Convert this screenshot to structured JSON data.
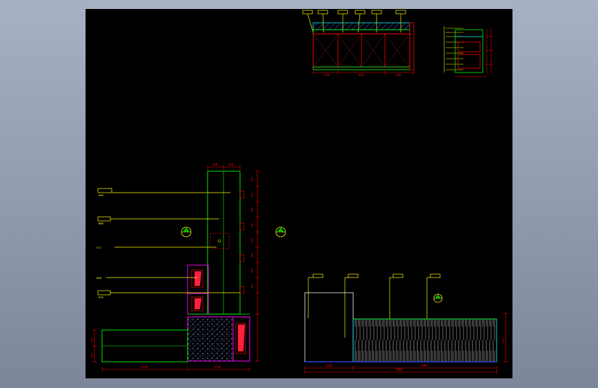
{
  "window": {
    "background_top": "#a7b0c2",
    "background_bottom": "#7d879c",
    "viewport_color": "#000000"
  },
  "colors": {
    "yellow": "#ffff00",
    "red": "#ff0000",
    "green": "#00ff00",
    "cyan": "#00ffff",
    "magenta": "#ff00ff",
    "white": "#ffffff",
    "blue": "#3050ff",
    "grey": "#8c8c8c"
  },
  "plan_view": {
    "label_texts": [
      "AAA",
      "BBB",
      "CCC",
      "DDD",
      "EEE"
    ],
    "dims_bottom": [
      "2140",
      "1550"
    ],
    "dims_left": [
      "450",
      "450"
    ],
    "dims_top": [
      "350",
      "150"
    ],
    "dims_right": [
      "600",
      "600",
      "600",
      "600",
      "600",
      "600",
      "600",
      "600"
    ],
    "section_markers": [
      "section-marker-a",
      "section-marker-b"
    ]
  },
  "elevation": {
    "dims_bottom": [
      "1100",
      "4800",
      "3860"
    ],
    "dims_right": [
      "500"
    ],
    "section_markers": [
      "section-marker-c"
    ]
  },
  "top_detail": {
    "dims_bottom": [
      "300",
      "600",
      "300"
    ]
  }
}
